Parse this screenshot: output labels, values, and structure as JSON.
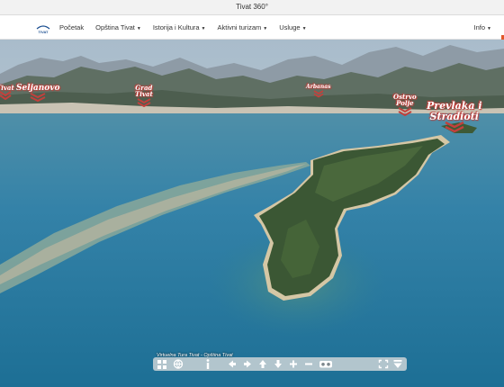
{
  "window": {
    "title": "Tivat 360°"
  },
  "logo": {
    "text": "TIVAT"
  },
  "nav": {
    "items": [
      {
        "label": "Početak",
        "dropdown": false
      },
      {
        "label": "Opština Tivat",
        "dropdown": true
      },
      {
        "label": "Istorija i Kultura",
        "dropdown": true
      },
      {
        "label": "Aktivni turizam",
        "dropdown": true
      },
      {
        "label": "Usluge",
        "dropdown": true
      }
    ],
    "right": {
      "label": "Info",
      "dropdown": true
    },
    "caret": "▼"
  },
  "hotspots": [
    {
      "label": "Tivat",
      "line2": ""
    },
    {
      "label": "Seljanovo",
      "line2": ""
    },
    {
      "label": "Grad",
      "line2": "Tivat"
    },
    {
      "label": "Arbanas",
      "line2": ""
    },
    {
      "label": "Ostrvo",
      "line2": "Polje"
    },
    {
      "label": "Prevlaka i",
      "line2": "Stradioti"
    }
  ],
  "tour": {
    "title": "Virtuelna Tura Tivat - Opština Tivat",
    "buttons": [
      "thumbnails-icon",
      "globe-icon",
      "info-icon",
      "arrow-left-icon",
      "arrow-right-icon",
      "arrow-up-icon",
      "arrow-down-icon",
      "zoom-in-icon",
      "zoom-out-icon",
      "vr-icon",
      "fullscreen-icon",
      "hide-menu-icon"
    ]
  },
  "colors": {
    "accent": "#e2572b",
    "hotspot": "#c3403c",
    "sea": "#2e7ea3",
    "sky": "#b9cad7"
  }
}
